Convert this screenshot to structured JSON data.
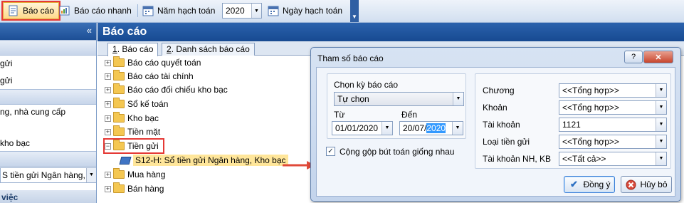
{
  "toolbar": {
    "bao_cao": "Báo cáo",
    "bao_cao_nhanh": "Báo cáo nhanh",
    "nam_hach_toan": "Năm hạch toán",
    "year_value": "2020",
    "ngay_hach_toan": "Ngày hạch toán"
  },
  "left_panel": {
    "collapse_glyph": "«",
    "rows": [
      "gửi",
      "gửi",
      "ng, nhà cung cấp",
      "kho bạc"
    ],
    "select_value": "S tiền gửi Ngân hàng, Kh",
    "bottom_text": "việc"
  },
  "main": {
    "title": "Báo cáo",
    "tabs": [
      {
        "key": "1",
        "label": ". Báo cáo"
      },
      {
        "key": "2",
        "label": ". Danh sách báo cáo"
      }
    ],
    "tree": [
      "Báo cáo quyết toán",
      "Báo cáo tài chính",
      "Báo cáo đối chiếu kho bạc",
      "Sổ kế toán",
      "Kho bạc",
      "Tiền mặt",
      "Tiền gửi",
      "Mua hàng",
      "Bán hàng"
    ],
    "leaf": "S12-H: Sổ tiền gửi Ngân hàng, Kho bạc"
  },
  "dialog": {
    "title": "Tham số báo cáo",
    "help_glyph": "?",
    "close_glyph": "✕",
    "period_label": "Chọn kỳ báo cáo",
    "period_value": "Tự chọn",
    "from_label": "Từ",
    "from_value": "01/01/2020",
    "to_label": "Đến",
    "to_value_prefix": "20/07/",
    "to_value_selected": "2020",
    "merge_label": "Cộng gộp bút toán giống nhau",
    "params": [
      {
        "label": "Chương",
        "value": "<<Tổng hợp>>"
      },
      {
        "label": "Khoản",
        "value": "<<Tổng hợp>>"
      },
      {
        "label": "Tài khoản",
        "value": "1121"
      },
      {
        "label": "Loại tiền gửi",
        "value": "<<Tổng hợp>>"
      },
      {
        "label": "Tài khoản NH, KB",
        "value": "<<Tất cả>>"
      }
    ],
    "ok_label": "Đồng ý",
    "cancel_label": "Hủy bỏ"
  },
  "colors": {
    "highlight": "#e53935",
    "header_blue": "#1d4f96",
    "leaf_highlight": "#ffe69a"
  }
}
